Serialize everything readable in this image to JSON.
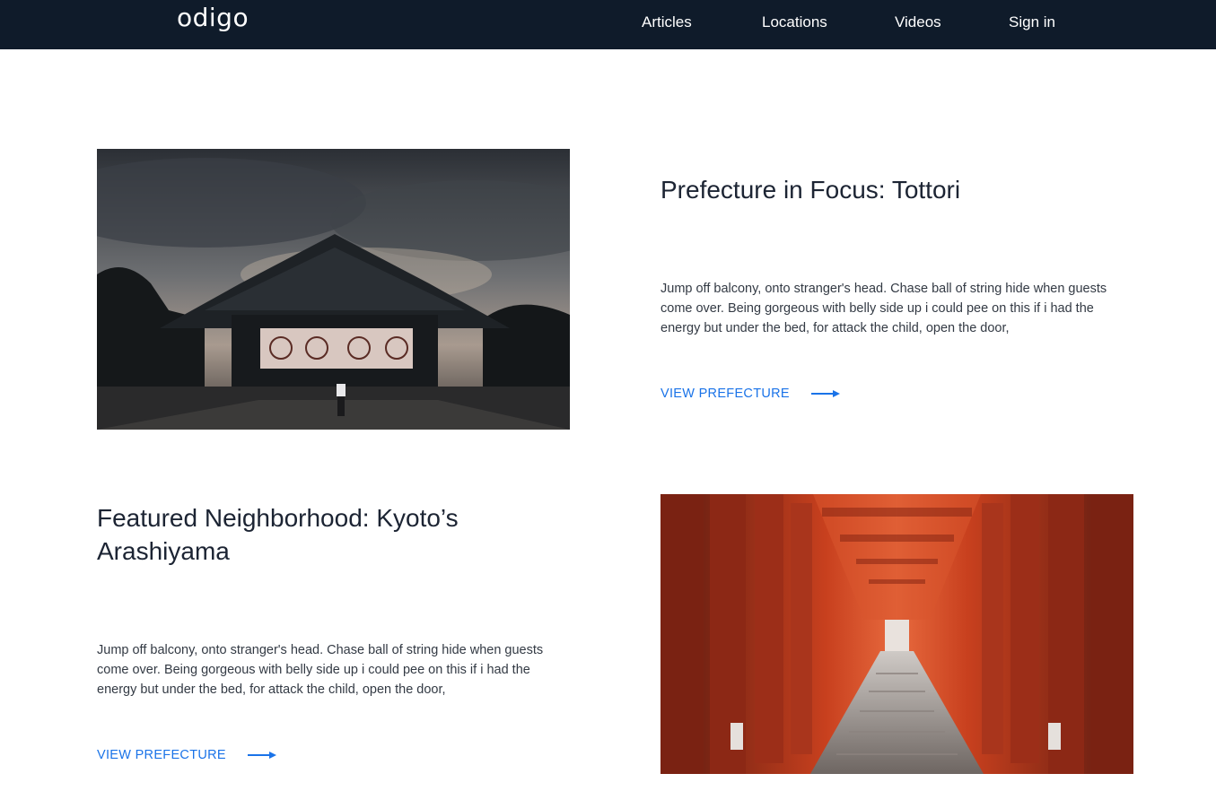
{
  "nav": {
    "logo": "odigo",
    "links": [
      "Articles",
      "Locations",
      "Videos",
      "Sign in"
    ]
  },
  "features": [
    {
      "title": "Prefecture in Focus: Tottori",
      "body": "Jump off balcony, onto stranger's head. Chase ball of string hide when guests come over. Being gorgeous with belly side up i could pee on this if i had the energy but under the bed, for attack the child, open the door,",
      "cta": "VIEW PREFECTURE"
    },
    {
      "title": "Featured Neighborhood: Kyoto’s Arashiyama",
      "body": "Jump off balcony, onto stranger's head. Chase ball of string hide when guests come over. Being gorgeous with belly side up i could pee on this if i had the energy but under the bed, for attack the child, open the door,",
      "cta": "VIEW PREFECTURE"
    }
  ],
  "colors": {
    "nav_background": "#0f1b2a",
    "link_blue": "#1a73e8",
    "heading_text": "#1c2433"
  }
}
